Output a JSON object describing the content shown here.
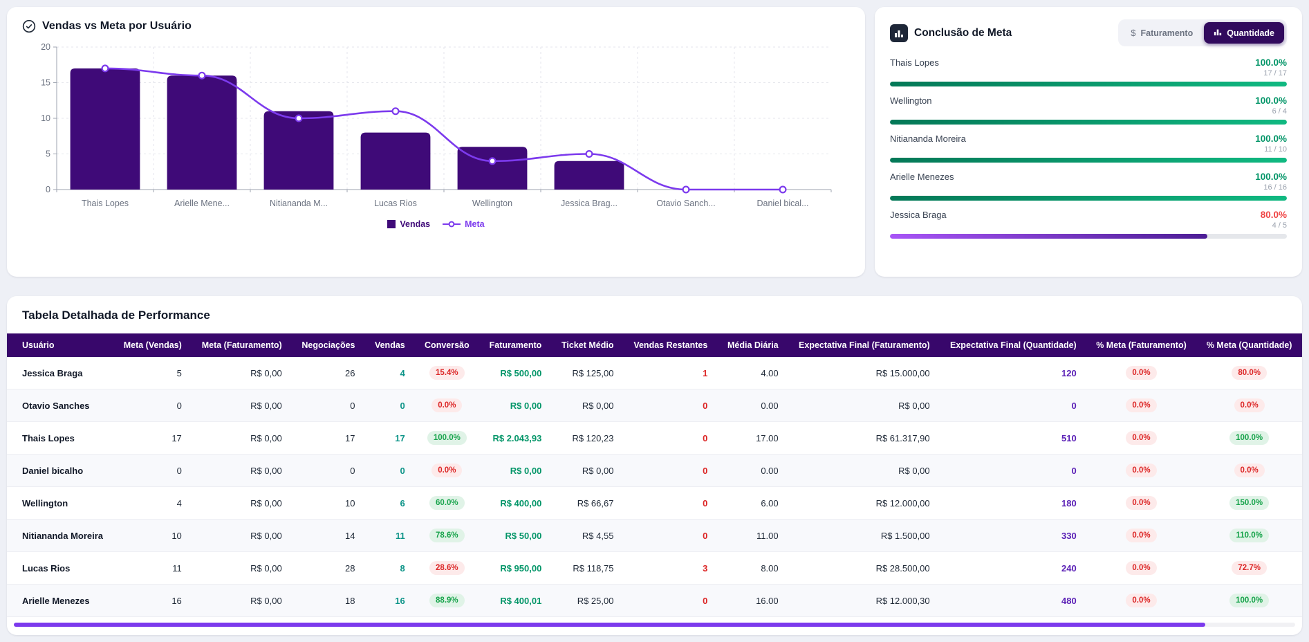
{
  "colors": {
    "bar_purple": "#3f0a78",
    "line_violet": "#7c3aed",
    "header_purple": "#38076b",
    "green": "#059669",
    "red": "#dc2626"
  },
  "chart_data": {
    "type": "bar",
    "title": "Vendas vs Meta por Usuário",
    "categories": [
      "Thais Lopes",
      "Arielle Mene...",
      "Nitiananda M...",
      "Lucas Rios",
      "Wellington",
      "Jessica Brag...",
      "Otavio Sanch...",
      "Daniel bical..."
    ],
    "series": [
      {
        "name": "Vendas",
        "type": "bar",
        "color": "#3f0a78",
        "values": [
          17,
          16,
          11,
          8,
          6,
          4,
          0,
          0
        ]
      },
      {
        "name": "Meta",
        "type": "line",
        "color": "#7c3aed",
        "values": [
          17,
          16,
          10,
          11,
          4,
          5,
          0,
          0
        ]
      }
    ],
    "ylim": [
      0,
      20
    ],
    "yticks": [
      0,
      5,
      10,
      15,
      20
    ],
    "grid": "dashed",
    "legend_position": "bottom"
  },
  "goal_panel": {
    "title": "Conclusão de Meta",
    "toggle": [
      "Faturamento",
      "Quantidade"
    ],
    "items": [
      {
        "name": "Thais Lopes",
        "pct": "100.0%",
        "count": "17 / 17",
        "value": 100,
        "pct_color": "green",
        "bar": "green"
      },
      {
        "name": "Wellington",
        "pct": "100.0%",
        "count": "6 / 4",
        "value": 100,
        "pct_color": "green",
        "bar": "green"
      },
      {
        "name": "Nitiananda Moreira",
        "pct": "100.0%",
        "count": "11 / 10",
        "value": 100,
        "pct_color": "green",
        "bar": "green"
      },
      {
        "name": "Arielle Menezes",
        "pct": "100.0%",
        "count": "16 / 16",
        "value": 100,
        "pct_color": "green",
        "bar": "green"
      },
      {
        "name": "Jessica Braga",
        "pct": "80.0%",
        "count": "4 / 5",
        "value": 80,
        "pct_color": "red",
        "bar": "purple"
      }
    ]
  },
  "table": {
    "title": "Tabela Detalhada de Performance",
    "columns": [
      "Usuário",
      "Meta (Vendas)",
      "Meta (Faturamento)",
      "Negociações",
      "Vendas",
      "Conversão",
      "Faturamento",
      "Ticket Médio",
      "Vendas Restantes",
      "Média Diária",
      "Expectativa Final (Faturamento)",
      "Expectativa Final (Quantidade)",
      "% Meta (Faturamento)",
      "% Meta (Quantidade)"
    ],
    "rows": [
      {
        "cells": [
          "Jessica Braga",
          "5",
          "R$ 0,00",
          "26",
          "4",
          {
            "pill": "15.4%",
            "tone": "red"
          },
          "R$ 500,00",
          "R$ 125,00",
          "1",
          "4.00",
          "R$ 15.000,00",
          "120",
          {
            "pill": "0.0%",
            "tone": "red"
          },
          {
            "pill": "80.0%",
            "tone": "red"
          }
        ]
      },
      {
        "cells": [
          "Otavio Sanches",
          "0",
          "R$ 0,00",
          "0",
          "0",
          {
            "pill": "0.0%",
            "tone": "red"
          },
          "R$ 0,00",
          "R$ 0,00",
          "0",
          "0.00",
          "R$ 0,00",
          "0",
          {
            "pill": "0.0%",
            "tone": "red"
          },
          {
            "pill": "0.0%",
            "tone": "red"
          }
        ]
      },
      {
        "cells": [
          "Thais Lopes",
          "17",
          "R$ 0,00",
          "17",
          "17",
          {
            "pill": "100.0%",
            "tone": "green"
          },
          "R$ 2.043,93",
          "R$ 120,23",
          "0",
          "17.00",
          "R$ 61.317,90",
          "510",
          {
            "pill": "0.0%",
            "tone": "red"
          },
          {
            "pill": "100.0%",
            "tone": "green"
          }
        ]
      },
      {
        "cells": [
          "Daniel bicalho",
          "0",
          "R$ 0,00",
          "0",
          "0",
          {
            "pill": "0.0%",
            "tone": "red"
          },
          "R$ 0,00",
          "R$ 0,00",
          "0",
          "0.00",
          "R$ 0,00",
          "0",
          {
            "pill": "0.0%",
            "tone": "red"
          },
          {
            "pill": "0.0%",
            "tone": "red"
          }
        ]
      },
      {
        "cells": [
          "Wellington",
          "4",
          "R$ 0,00",
          "10",
          "6",
          {
            "pill": "60.0%",
            "tone": "green"
          },
          "R$ 400,00",
          "R$ 66,67",
          "0",
          "6.00",
          "R$ 12.000,00",
          "180",
          {
            "pill": "0.0%",
            "tone": "red"
          },
          {
            "pill": "150.0%",
            "tone": "green"
          }
        ]
      },
      {
        "cells": [
          "Nitiananda Moreira",
          "10",
          "R$ 0,00",
          "14",
          "11",
          {
            "pill": "78.6%",
            "tone": "green"
          },
          "R$ 50,00",
          "R$ 4,55",
          "0",
          "11.00",
          "R$ 1.500,00",
          "330",
          {
            "pill": "0.0%",
            "tone": "red"
          },
          {
            "pill": "110.0%",
            "tone": "green"
          }
        ]
      },
      {
        "cells": [
          "Lucas Rios",
          "11",
          "R$ 0,00",
          "28",
          "8",
          {
            "pill": "28.6%",
            "tone": "red"
          },
          "R$ 950,00",
          "R$ 118,75",
          "3",
          "8.00",
          "R$ 28.500,00",
          "240",
          {
            "pill": "0.0%",
            "tone": "red"
          },
          {
            "pill": "72.7%",
            "tone": "red"
          }
        ]
      },
      {
        "cells": [
          "Arielle Menezes",
          "16",
          "R$ 0,00",
          "18",
          "16",
          {
            "pill": "88.9%",
            "tone": "green"
          },
          "R$ 400,01",
          "R$ 25,00",
          "0",
          "16.00",
          "R$ 12.000,30",
          "480",
          {
            "pill": "0.0%",
            "tone": "red"
          },
          {
            "pill": "100.0%",
            "tone": "green"
          }
        ]
      }
    ]
  }
}
